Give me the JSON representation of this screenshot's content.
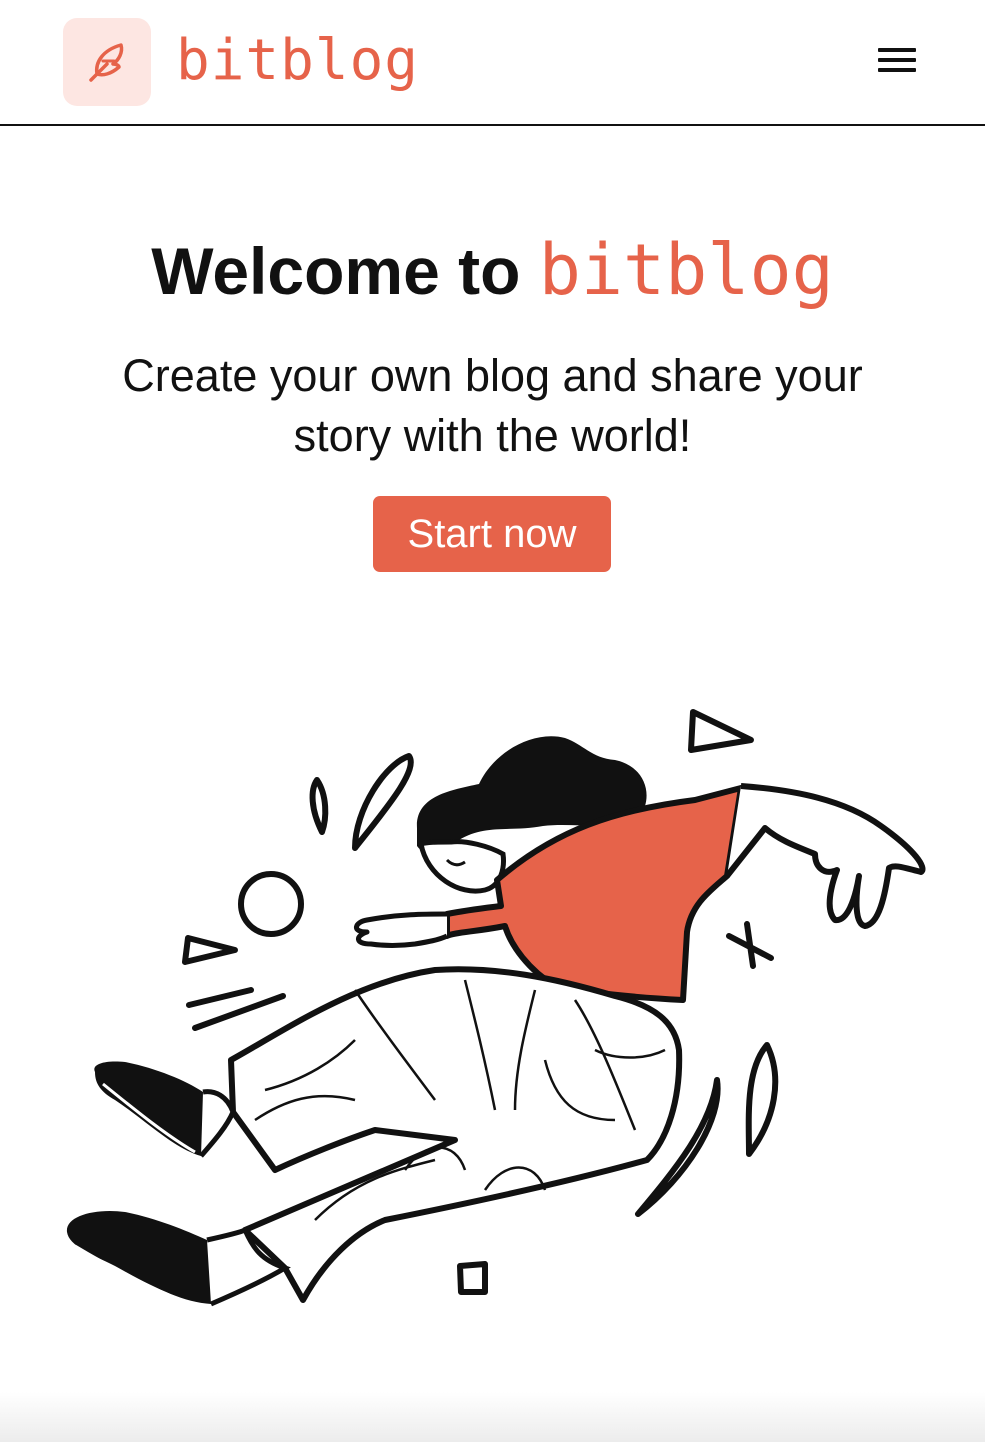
{
  "header": {
    "brand": "bitblog",
    "logo_icon": "feather-icon",
    "menu_icon": "hamburger-menu-icon"
  },
  "hero": {
    "title_prefix": "Welcome to",
    "title_brand": "bitblog",
    "subtitle": "Create your own blog and share your story with the world!",
    "cta_label": "Start now"
  },
  "illustration": {
    "subject": "person-jumping-illustration"
  },
  "colors": {
    "accent": "#e6634a",
    "logo_bg": "#fde6e2",
    "text": "#111111",
    "background": "#ffffff"
  }
}
